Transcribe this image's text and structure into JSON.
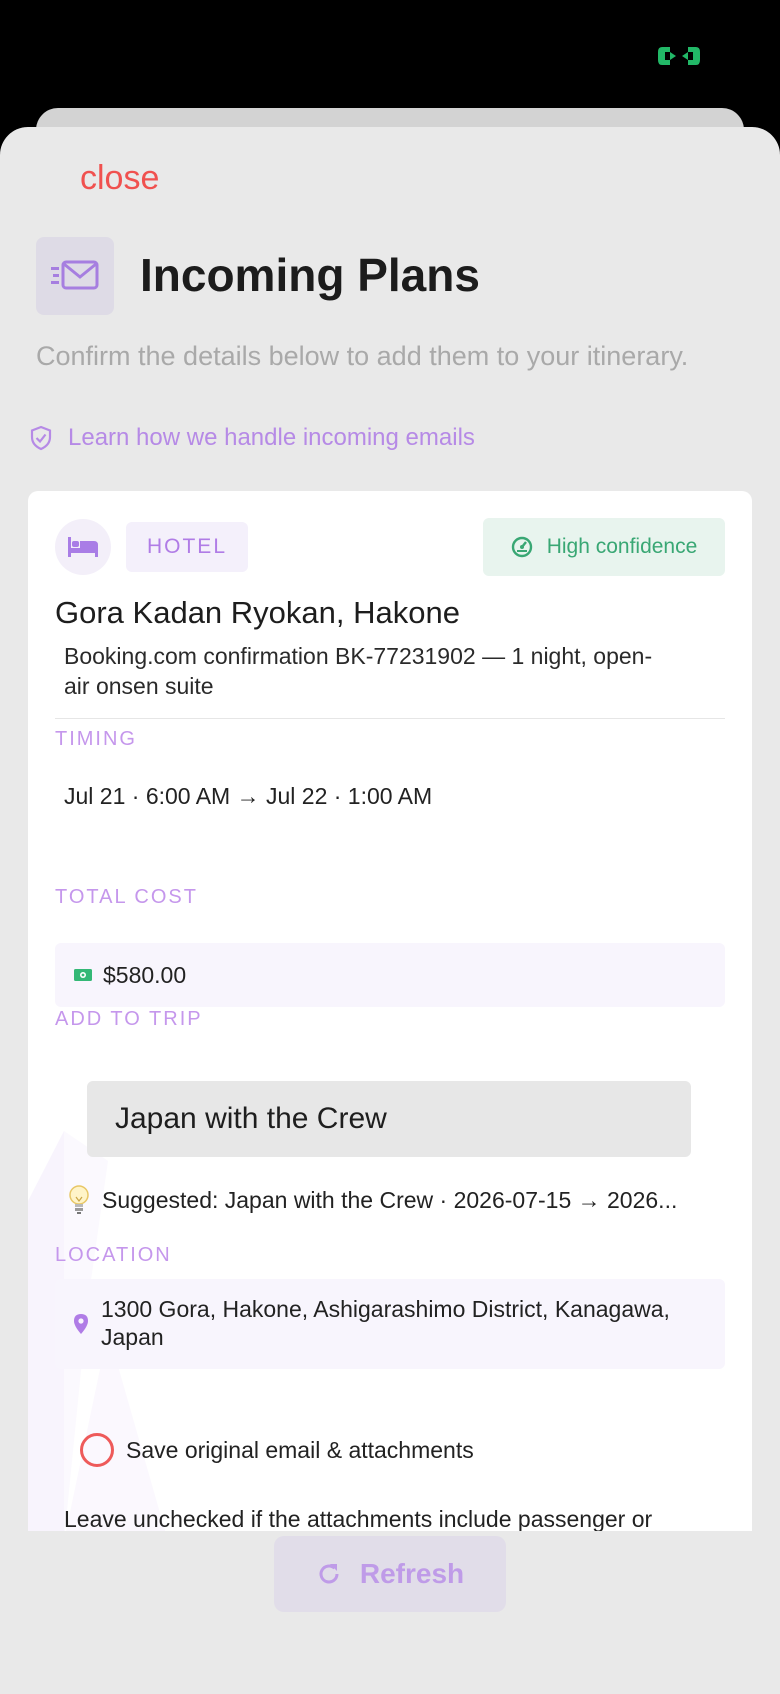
{
  "header": {
    "close_label": "close",
    "title": "Incoming Plans",
    "subtitle": "Confirm the details below to add them to your itinerary.",
    "learn_link": "Learn how we handle incoming emails"
  },
  "card": {
    "type": "HOTEL",
    "confidence": "High confidence",
    "title": "Gora Kadan Ryokan, Hakone",
    "description": "Booking.com confirmation BK-77231902 — 1 night, open-air onsen suite",
    "timing_label": "TIMING",
    "timing_value": "Jul 21 · 6:00 AM → Jul 22 · 1:00 AM",
    "cost_label": "TOTAL COST",
    "cost_value": "$580.00",
    "trip_label": "ADD TO TRIP",
    "trip_value": "Japan with the Crew",
    "suggestion": "Suggested: Japan with the Crew · 2026-07-15 → 2026...",
    "location_label": "LOCATION",
    "location_value": "1300 Gora, Hakone, Ashigarashimo District, Kanagawa, Japan",
    "save_label": "Save original email & attachments",
    "note": "Leave unchecked if the attachments include passenger or"
  },
  "footer": {
    "refresh_label": "Refresh"
  },
  "colors": {
    "accent": "#b68ae6",
    "close": "#f0514f",
    "confidence": "#39a774"
  }
}
